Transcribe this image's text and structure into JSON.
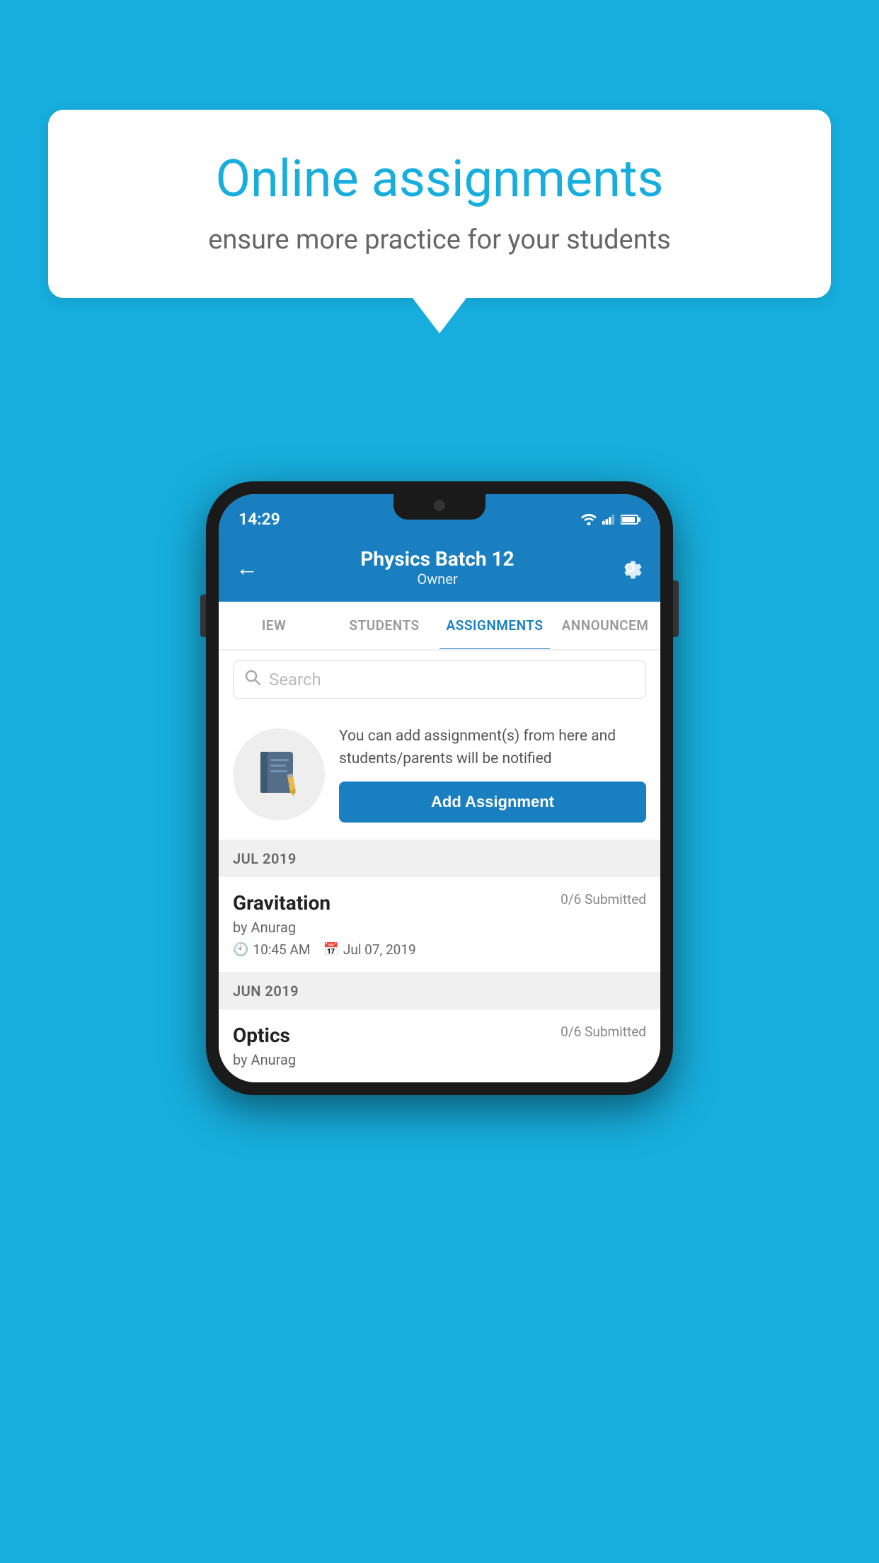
{
  "background_color": "#17AEDE",
  "speech_bubble": {
    "title": "Online assignments",
    "subtitle": "ensure more practice for your students"
  },
  "phone": {
    "status_bar": {
      "time": "14:29",
      "wifi": true,
      "signal": true,
      "battery": true
    },
    "header": {
      "title": "Physics Batch 12",
      "subtitle": "Owner",
      "back_label": "←",
      "settings_label": "⚙"
    },
    "tabs": [
      {
        "id": "iew",
        "label": "IEW",
        "active": false
      },
      {
        "id": "students",
        "label": "STUDENTS",
        "active": false
      },
      {
        "id": "assignments",
        "label": "ASSIGNMENTS",
        "active": true
      },
      {
        "id": "announcements",
        "label": "ANNOUNCEM",
        "active": false
      }
    ],
    "search": {
      "placeholder": "Search"
    },
    "add_assignment_section": {
      "info_text": "You can add assignment(s) from here and students/parents will be notified",
      "button_label": "Add Assignment"
    },
    "sections": [
      {
        "month": "JUL 2019",
        "assignments": [
          {
            "name": "Gravitation",
            "submitted": "0/6 Submitted",
            "by": "by Anurag",
            "time": "10:45 AM",
            "date": "Jul 07, 2019"
          }
        ]
      },
      {
        "month": "JUN 2019",
        "assignments": [
          {
            "name": "Optics",
            "submitted": "0/6 Submitted",
            "by": "by Anurag",
            "time": "",
            "date": ""
          }
        ]
      }
    ]
  }
}
